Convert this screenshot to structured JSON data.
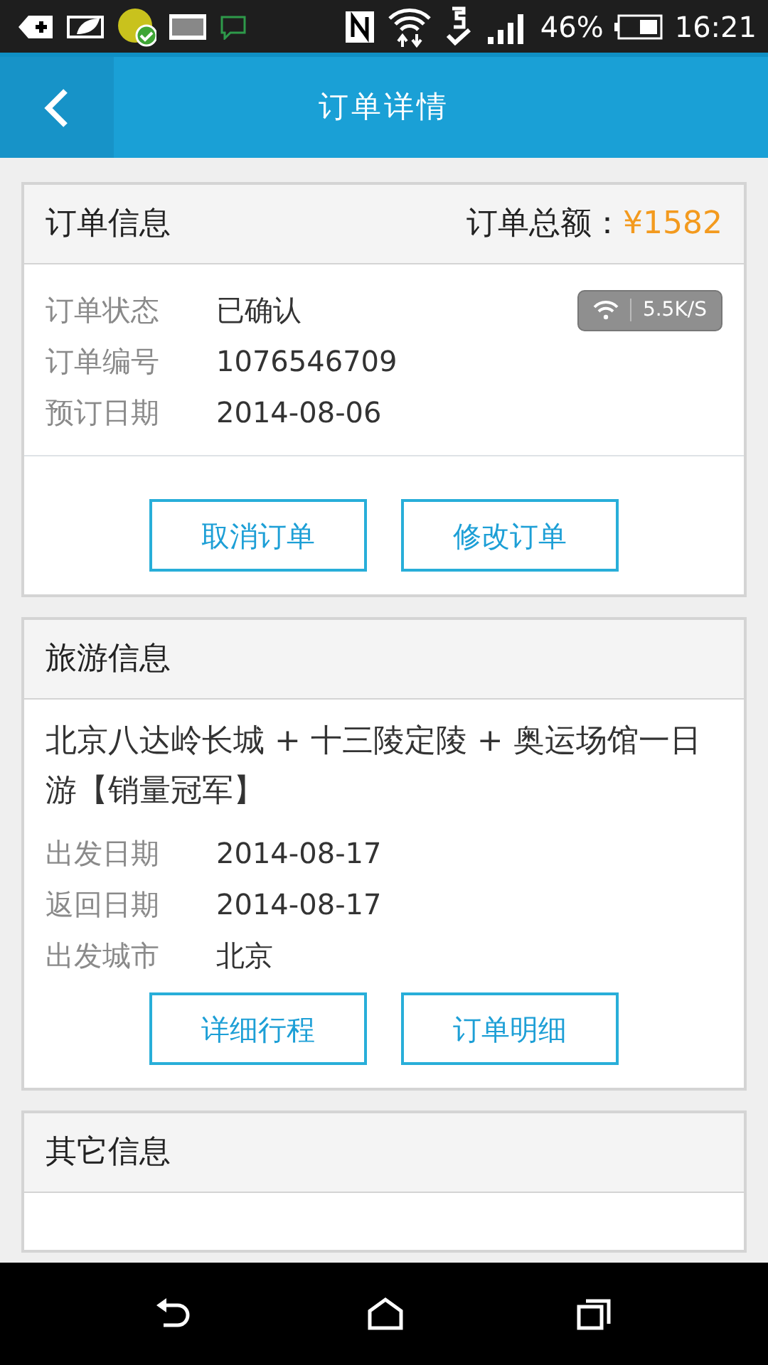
{
  "status_bar": {
    "battery": "46%",
    "time": "16:21"
  },
  "header": {
    "title": "订单详情"
  },
  "sections": [
    {
      "title": "订单信息",
      "total_label": "订单总额：",
      "total": "¥1582",
      "speed": "5.5K/S",
      "fields": [
        {
          "label": "订单状态",
          "value": "已确认"
        },
        {
          "label": "订单编号",
          "value": "1076546709"
        },
        {
          "label": "预订日期",
          "value": "2014-08-06"
        }
      ],
      "buttons": [
        "取消订单",
        "修改订单"
      ]
    },
    {
      "title": "旅游信息",
      "description": "北京八达岭长城 + 十三陵定陵 + 奥运场馆一日游【销量冠军】",
      "fields": [
        {
          "label": "出发日期",
          "value": "2014-08-17"
        },
        {
          "label": "返回日期",
          "value": "2014-08-17"
        },
        {
          "label": "出发城市",
          "value": "北京"
        }
      ],
      "buttons": [
        "详细行程",
        "订单明细"
      ]
    },
    {
      "title": "其它信息"
    }
  ]
}
